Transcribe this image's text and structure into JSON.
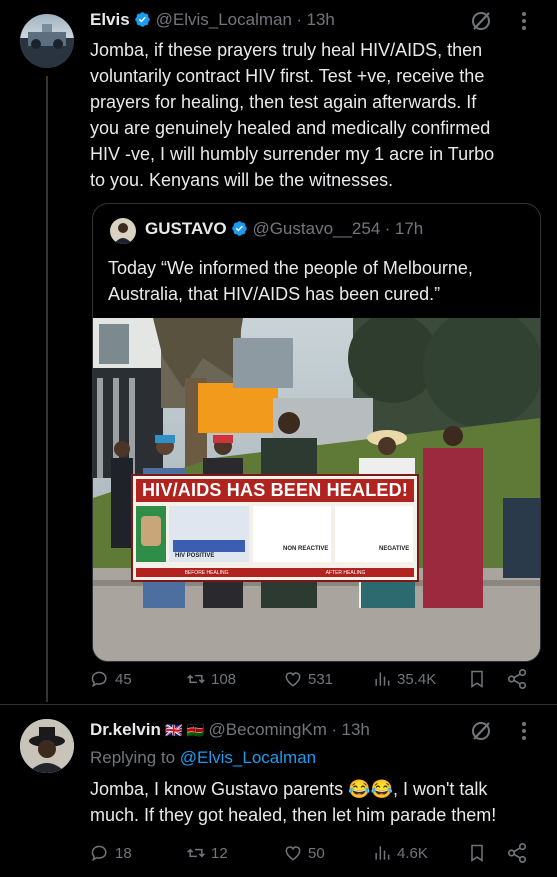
{
  "tweet1": {
    "display_name": "Elvis",
    "handle": "@Elvis_Localman",
    "separator": "·",
    "time": "13h",
    "text_lines": [
      "Jomba, if these prayers truly heal HIV/AIDS, then",
      "voluntarily contract HIV first. Test +ve, receive the",
      "prayers for healing, then test again afterwards. If",
      "you are genuinely healed and medically confirmed",
      "HIV -ve, I will humbly surrender my 1 acre in Turbo",
      "to you. Kenyans will be the witnesses."
    ],
    "quote": {
      "display_name": "GUSTAVO",
      "handle": "@Gustavo__254",
      "separator": "·",
      "time": "17h",
      "text_lines": [
        "Today “We informed the people of Melbourne,",
        "Australia, that HIV/AIDS has been cured.”"
      ],
      "banner": {
        "title": "HIV/AIDS HAS BEEN HEALED!",
        "hiv_positive": "HIV POSITIVE",
        "non_reactive": "NON REACTIVE",
        "negative": "NEGATIVE",
        "caption_left": "BEFORE HEALING",
        "caption_right": "AFTER HEALING"
      }
    },
    "stats": {
      "replies": "45",
      "reposts": "108",
      "likes": "531",
      "views": "35.4K"
    }
  },
  "tweet2": {
    "display_name": "Dr.kelvin",
    "flags": "🇬🇧 🇰🇪",
    "handle": "@BecomingKm",
    "separator": "·",
    "time": "13h",
    "replying_prefix": "Replying to ",
    "replying_handle": "@Elvis_Localman",
    "text_line1": "Jomba, I know Gustavo parents 😂😂, I won't talk",
    "text_line2": "much. If they got healed, then let him parade them!",
    "stats": {
      "replies": "18",
      "reposts": "12",
      "likes": "50",
      "views": "4.6K"
    }
  },
  "colors": {
    "background": "#000000",
    "text": "#e7e9ea",
    "muted": "#71767b",
    "link": "#1d9bf0",
    "verified": "#1d9bf0",
    "banner_red": "#b0231f"
  }
}
